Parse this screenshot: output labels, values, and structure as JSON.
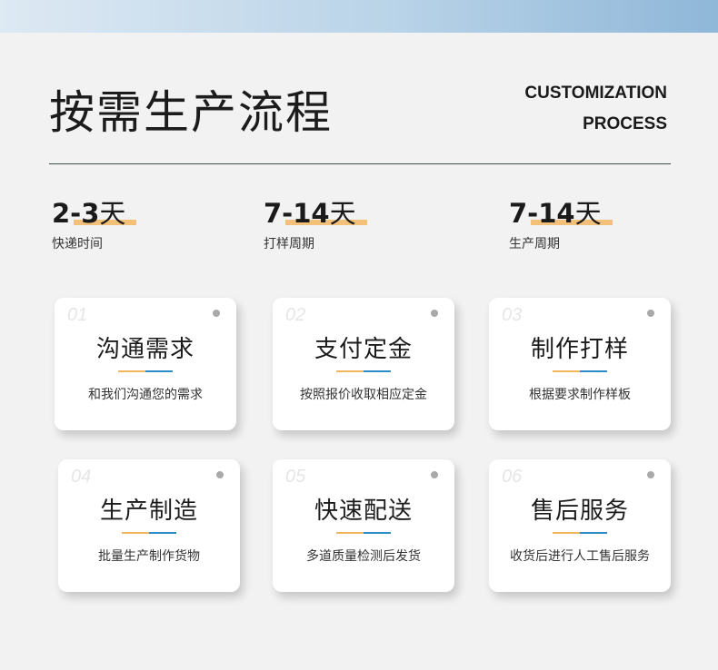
{
  "header": {
    "title_cn": "按需生产流程",
    "title_en_line1": "CUSTOMIZATION",
    "title_en_line2": "PROCESS"
  },
  "stats": [
    {
      "value": "2-3",
      "unit": "天",
      "label": "快递时间"
    },
    {
      "value": "7-14",
      "unit": "天",
      "label": "打样周期"
    },
    {
      "value": "7-14",
      "unit": "天",
      "label": "生产周期"
    }
  ],
  "steps": [
    {
      "index": "01",
      "title": "沟通需求",
      "desc": "和我们沟通您的需求"
    },
    {
      "index": "02",
      "title": "支付定金",
      "desc": "按照报价收取相应定金"
    },
    {
      "index": "03",
      "title": "制作打样",
      "desc": "根据要求制作样板"
    },
    {
      "index": "04",
      "title": "生产制造",
      "desc": "批量生产制作货物"
    },
    {
      "index": "05",
      "title": "快速配送",
      "desc": "多道质量检测后发货"
    },
    {
      "index": "06",
      "title": "售后服务",
      "desc": "收货后进行人工售后服务"
    }
  ],
  "colors": {
    "accent_orange": "#f3c07a",
    "accent_blue": "#2e8bc9",
    "background": "#f2f2f2"
  }
}
